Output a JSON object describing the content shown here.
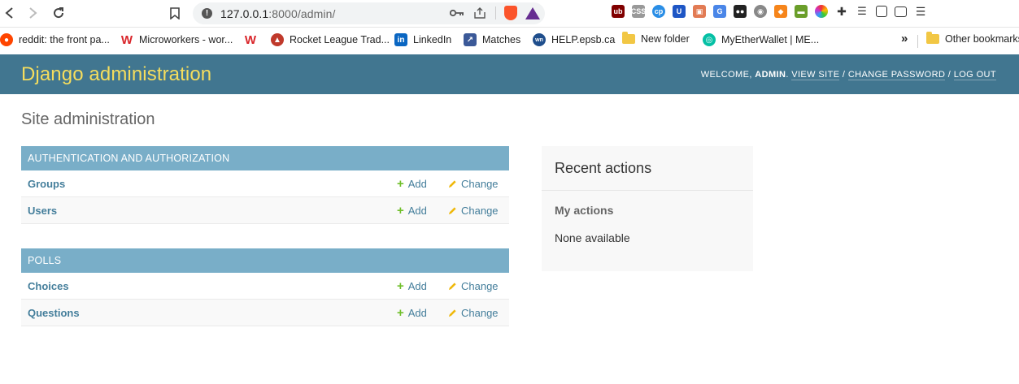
{
  "browser": {
    "url_host": "127.0.0.1",
    "url_rest": ":8000/admin/",
    "bookmarks": [
      {
        "label": "reddit: the front pa...",
        "icon": "reddit-icon",
        "color": "#ff4500"
      },
      {
        "label": "Microworkers - wor...",
        "icon": "microworkers-icon",
        "color": "#d9262b"
      },
      {
        "label": "Rocket League Trad...",
        "icon": "rocket-league-icon",
        "color": "#d9262b"
      },
      {
        "label": "LinkedIn",
        "icon": "linkedin-icon",
        "color": "#0a66c2"
      },
      {
        "label": "Matches",
        "icon": "matches-icon",
        "color": "#3b5998"
      },
      {
        "label": "HELP.epsb.ca",
        "icon": "epsb-icon",
        "color": "#1f4e8c"
      },
      {
        "label": "New folder",
        "icon": "folder-icon",
        "color": "#f2c744"
      },
      {
        "label": "MyEtherWallet | ME...",
        "icon": "myetherwallet-icon",
        "color": "#05c0a5"
      }
    ],
    "overflow_label": "»",
    "other_bookmarks": "Other bookmarks"
  },
  "header": {
    "branding": "Django administration",
    "welcome": "Welcome,",
    "username": "admin",
    "view_site": "View site",
    "change_password": "Change password",
    "log_out": "Log out"
  },
  "page_title": "Site administration",
  "apps": [
    {
      "caption": "Authentication and Authorization",
      "models": [
        {
          "name": "Groups",
          "add": "Add",
          "change": "Change"
        },
        {
          "name": "Users",
          "add": "Add",
          "change": "Change"
        }
      ]
    },
    {
      "caption": "Polls",
      "models": [
        {
          "name": "Choices",
          "add": "Add",
          "change": "Change"
        },
        {
          "name": "Questions",
          "add": "Add",
          "change": "Change"
        }
      ]
    }
  ],
  "recent_actions": {
    "title": "Recent actions",
    "subtitle": "My actions",
    "empty": "None available"
  },
  "colors": {
    "header_bg": "#417690",
    "branding": "#f5dd5d",
    "caption_bg": "#79aec8",
    "link": "#447e9b",
    "add_icon": "#70bf2b",
    "change_icon": "#efb80b"
  }
}
